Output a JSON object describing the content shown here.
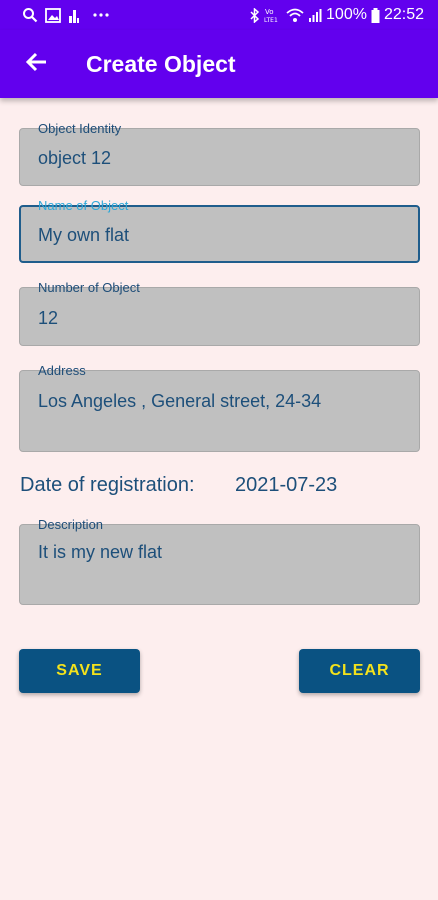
{
  "status_bar": {
    "battery": "100%",
    "time": "22:52",
    "left_icons": [
      "search-icon",
      "image-icon",
      "chart-icon",
      "more-icon"
    ],
    "right_icons": [
      "bluetooth-icon",
      "volte-icon",
      "wifi-icon",
      "signal-icon",
      "battery-icon"
    ],
    "volte_label": "VoLTE"
  },
  "app_bar": {
    "title": "Create Object",
    "back_icon": "arrow-left-icon",
    "color": "#6200ee"
  },
  "form": {
    "object_identity": {
      "label": "Object Identity",
      "value": "object 12"
    },
    "name_of_object": {
      "label": "Name of Object",
      "value": "My own flat",
      "focused": true
    },
    "number_of_object": {
      "label": "Number of Object",
      "value": "12"
    },
    "address": {
      "label": "Address",
      "value": "Los Angeles , General street, 24-34"
    },
    "date_of_registration": {
      "label": "Date of registration:",
      "value": "2021-07-23"
    },
    "description": {
      "label": "Description",
      "value": "It is my new flat"
    }
  },
  "buttons": {
    "save_label": "SAVE",
    "clear_label": "CLEAR",
    "button_color": "#0a5282",
    "button_text_color": "#f3e21c"
  }
}
